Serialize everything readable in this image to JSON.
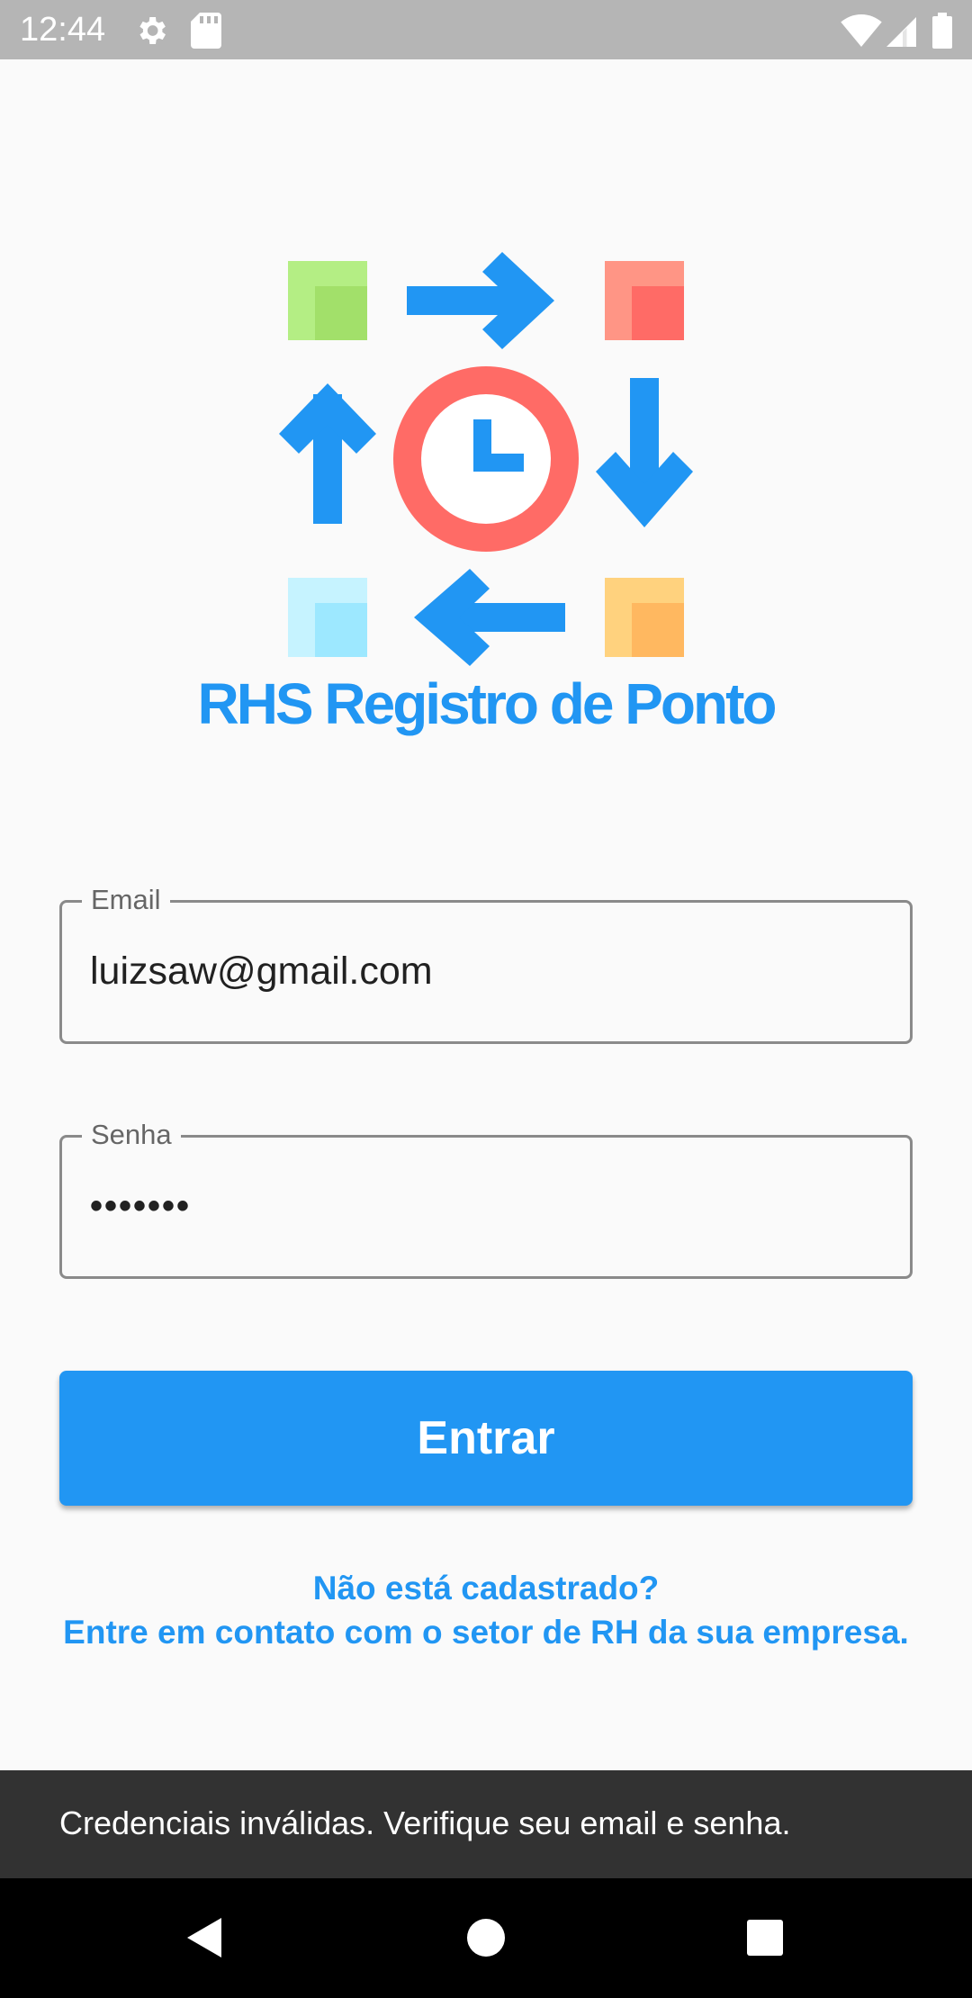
{
  "status_bar": {
    "time": "12:44",
    "icons": [
      "gear-icon",
      "sd-card-icon",
      "wifi-icon",
      "cellular-signal-icon",
      "battery-icon"
    ]
  },
  "logo": {
    "title": "RHS Registro de Ponto",
    "colors": {
      "arrows": "#2196f3",
      "clock_ring": "#ff6b66",
      "green_square": "#a8e873",
      "red_square": "#ff7a6e",
      "cyan_square": "#a6ecff",
      "orange_square": "#ffc46e"
    }
  },
  "form": {
    "email": {
      "label": "Email",
      "value": "luizsaw@gmail.com"
    },
    "password": {
      "label": "Senha",
      "value": "•••••••"
    },
    "submit_label": "Entrar"
  },
  "signup_hint": {
    "line1": "Não está cadastrado?",
    "line2": "Entre em contato com o setor de RH da sua empresa."
  },
  "snackbar": {
    "message": "Credenciais inválidas. Verifique seu email e senha."
  },
  "nav_bar": {
    "buttons": [
      "back-icon",
      "home-icon",
      "recents-icon"
    ]
  },
  "colors": {
    "accent": "#2196f3",
    "snackbar_bg": "#323232",
    "status_bar_bg": "#b5b5b5"
  }
}
